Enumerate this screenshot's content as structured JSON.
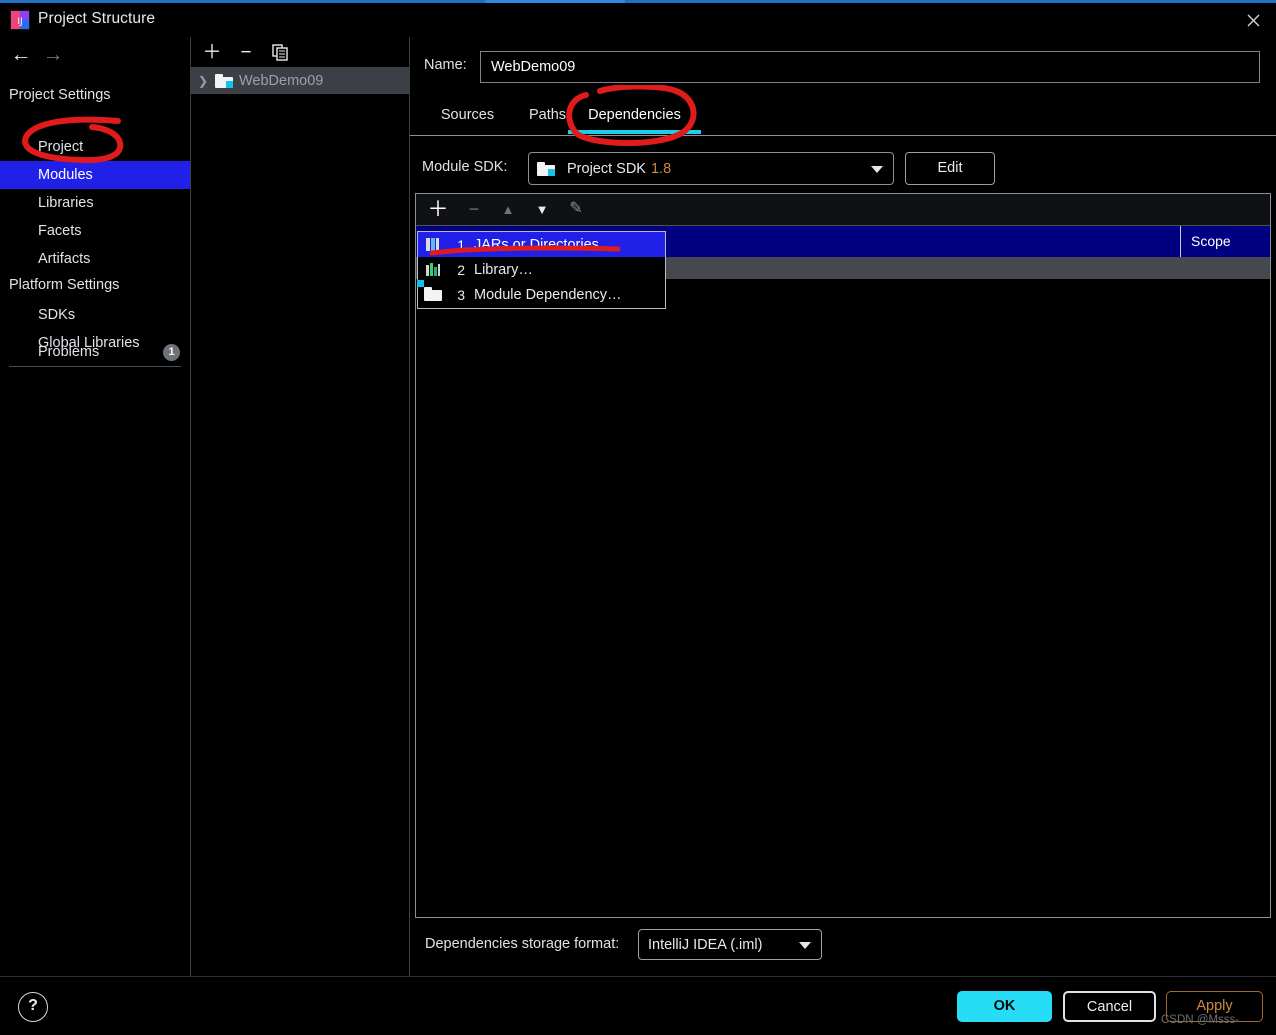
{
  "window": {
    "title": "Project Structure",
    "app_icon": "intellij-idea-icon",
    "close_icon": "close-icon",
    "accent_blue": "#1f6fc4"
  },
  "nav": {
    "back_icon": "arrow-left-icon",
    "forward_icon": "arrow-right-icon"
  },
  "sidebar": {
    "groups": [
      {
        "label": "Project Settings"
      },
      {
        "label": "Platform Settings"
      }
    ],
    "project_settings_items": [
      {
        "label": "Project",
        "selected": false
      },
      {
        "label": "Modules",
        "selected": true
      },
      {
        "label": "Libraries",
        "selected": false
      },
      {
        "label": "Facets",
        "selected": false
      },
      {
        "label": "Artifacts",
        "selected": false
      }
    ],
    "platform_settings_items": [
      {
        "label": "SDKs",
        "selected": false
      },
      {
        "label": "Global Libraries",
        "selected": false
      }
    ],
    "problems": {
      "label": "Problems",
      "count": "1"
    },
    "selected_color": "#2020e8"
  },
  "tree": {
    "toolbar": [
      {
        "icon": "plus-icon",
        "label": "+"
      },
      {
        "icon": "minus-icon",
        "label": "−"
      },
      {
        "icon": "copy-icon",
        "label": "❐"
      }
    ],
    "nodes": [
      {
        "label": "WebDemo09",
        "icon": "module-folder-icon",
        "chevron": "›",
        "selected": true
      }
    ]
  },
  "module": {
    "name_label": "Name:",
    "name_value": "WebDemo09",
    "tabs": [
      {
        "label": "Sources",
        "active": false
      },
      {
        "label": "Paths",
        "active": false
      },
      {
        "label": "Dependencies",
        "active": true
      }
    ],
    "sdk_label": "Module SDK:",
    "sdk_value": "Project SDK",
    "sdk_version": "1.8",
    "sdk_icon": "sdk-folder-icon",
    "edit_button": "Edit",
    "storage_label": "Dependencies storage format:",
    "storage_value": "IntelliJ IDEA (.iml)"
  },
  "deps_toolbar": [
    {
      "icon": "add-icon",
      "glyph": "＋",
      "enabled": true
    },
    {
      "icon": "remove-icon",
      "glyph": "−",
      "enabled": false
    },
    {
      "icon": "move-up-icon",
      "glyph": "▲",
      "enabled": false
    },
    {
      "icon": "move-down-icon",
      "glyph": "▼",
      "enabled": true
    },
    {
      "icon": "edit-pencil-icon",
      "glyph": "✎",
      "enabled": false
    }
  ],
  "deps_table": {
    "columns": [
      "",
      "Scope"
    ],
    "rows": []
  },
  "popup_menu": {
    "items": [
      {
        "num": "1",
        "label": "JARs or Directories…",
        "icon": "jars-icon",
        "selected": true
      },
      {
        "num": "2",
        "label": "Library…",
        "icon": "library-icon",
        "selected": false
      },
      {
        "num": "3",
        "label": "Module Dependency…",
        "icon": "module-dependency-icon",
        "selected": false
      }
    ]
  },
  "footer": {
    "help_icon": "help-question-icon",
    "help_glyph": "?",
    "ok": "OK",
    "cancel": "Cancel",
    "apply": "Apply",
    "ok_color": "#27dcf5",
    "apply_color": "#d08b3f"
  },
  "watermark": "CSDN @Msss-",
  "annotations": {
    "color": "#e01b1b",
    "marks": [
      "circle-around-modules",
      "circle-around-dependencies-tab",
      "underline-jars-or-directories"
    ]
  }
}
